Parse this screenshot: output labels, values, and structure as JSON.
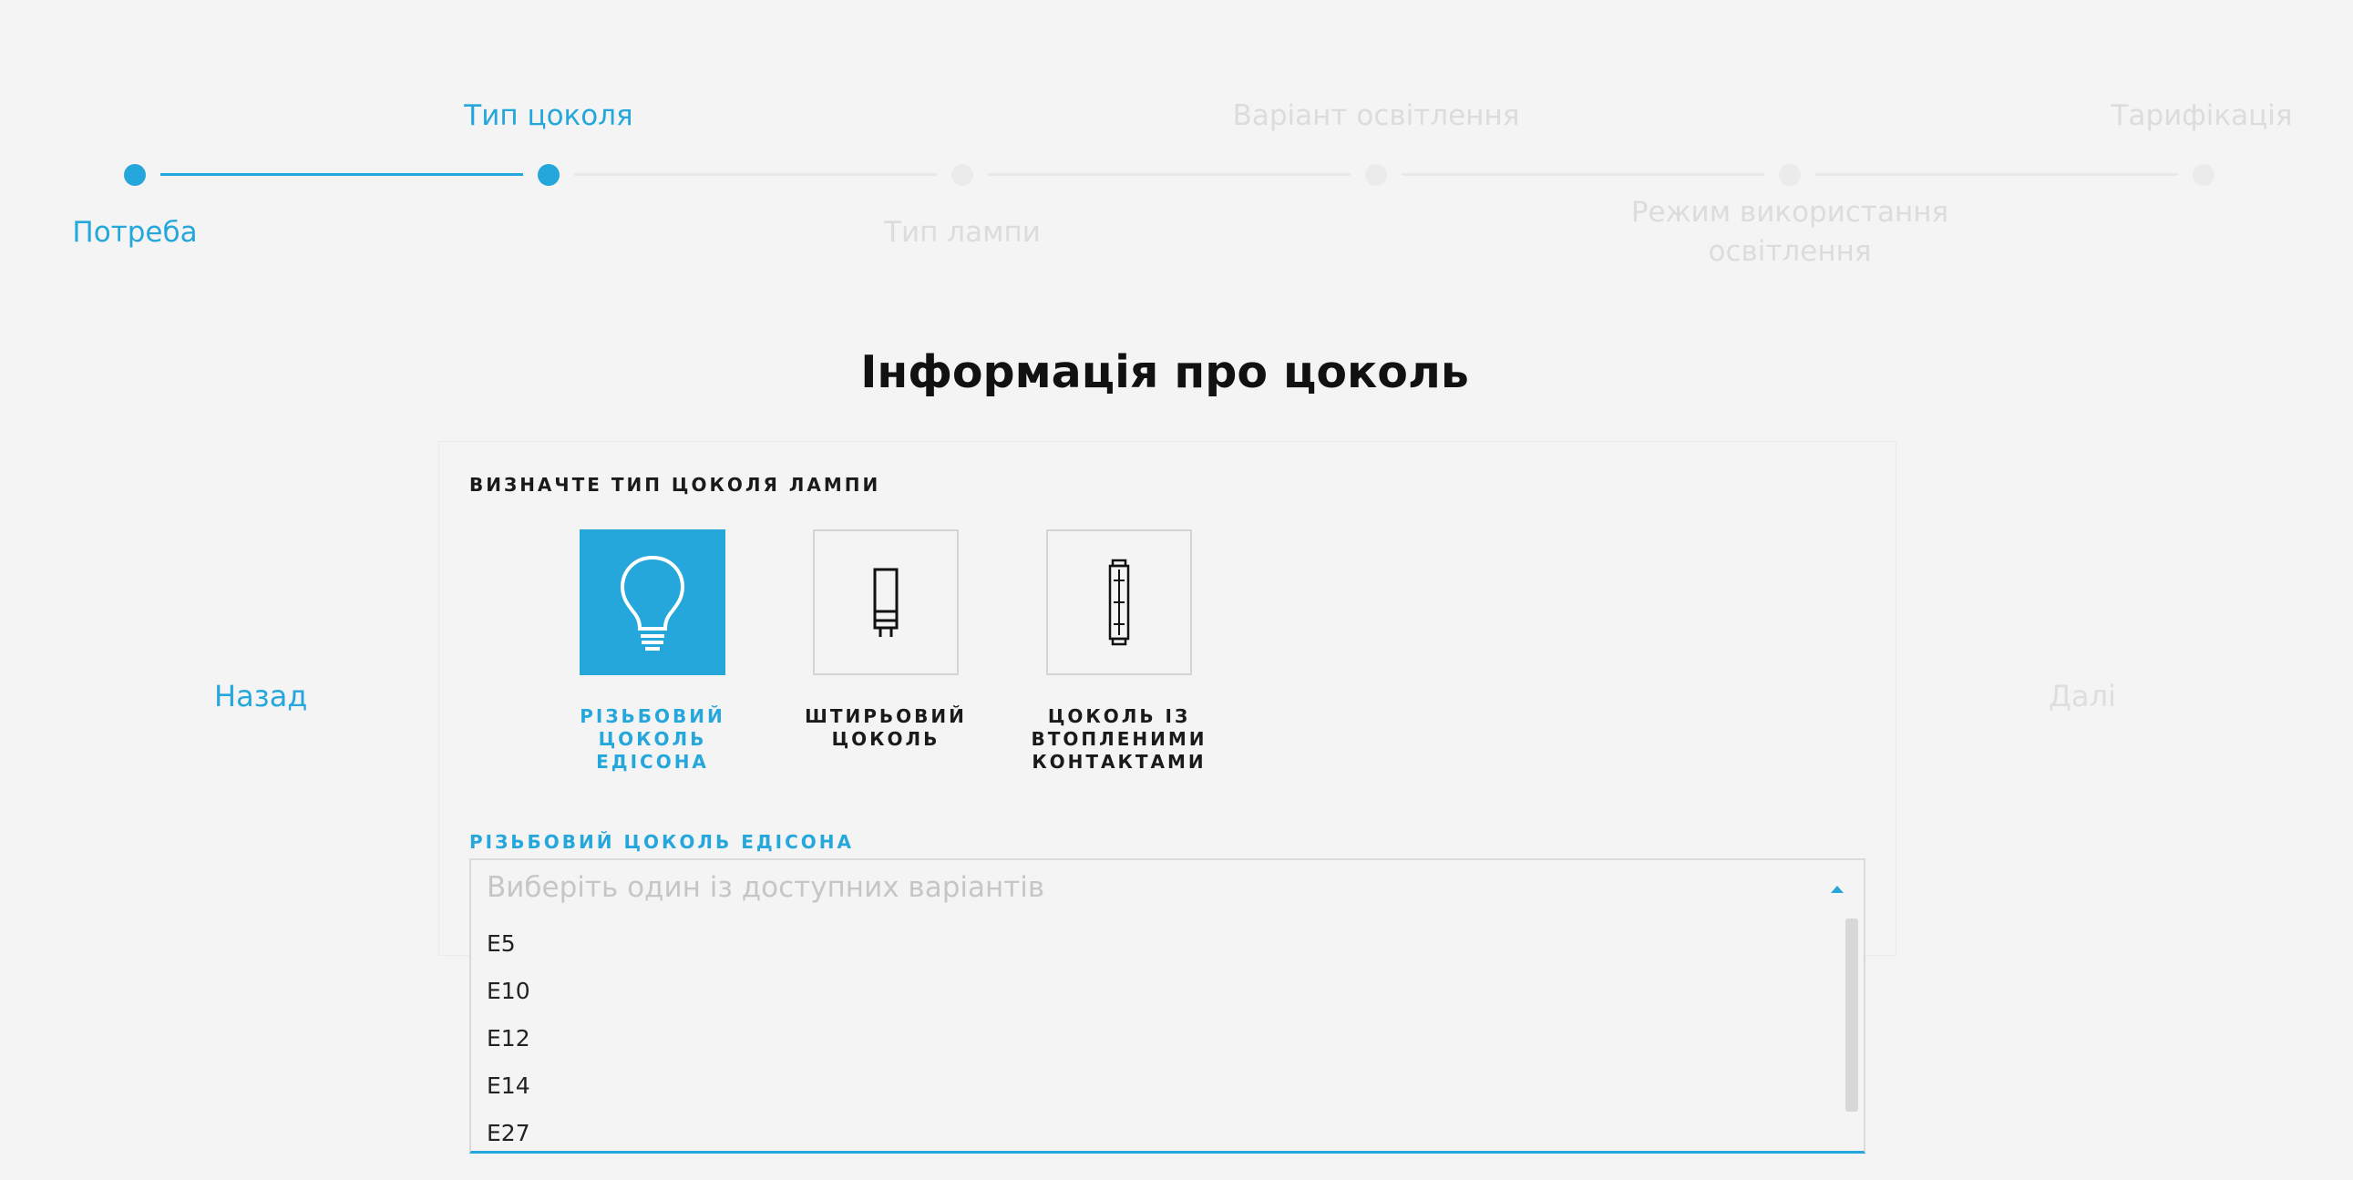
{
  "stepper": {
    "steps": [
      {
        "label": "Потреба",
        "state": "done"
      },
      {
        "label": "Тип цоколя",
        "state": "current"
      },
      {
        "label": "Тип лампи",
        "state": "todo"
      },
      {
        "label": "Варіант освітлення",
        "state": "todo"
      },
      {
        "label": "Режим використання освітлення",
        "state": "todo"
      },
      {
        "label": "Тарифікація",
        "state": "todo"
      }
    ],
    "step5_line1": "Режим використання",
    "step5_line2": "освітлення"
  },
  "nav": {
    "back": "Назад",
    "next": "Далі"
  },
  "page_title": "Інформація про цоколь",
  "form": {
    "section_label": "ВИЗНАЧТЕ ТИП ЦОКОЛЯ ЛАМПИ",
    "options": [
      {
        "line1": "РІЗЬБОВИЙ",
        "line2": "ЦОКОЛЬ ЕДІСОНА",
        "line3": "",
        "icon": "bulb-icon",
        "selected": true
      },
      {
        "line1": "ШТИРЬОВИЙ",
        "line2": "ЦОКОЛЬ",
        "line3": "",
        "icon": "pin-base-lamp-icon",
        "selected": false
      },
      {
        "line1": "ЦОКОЛЬ ІЗ",
        "line2": "ВТОПЛЕНИМИ",
        "line3": "КОНТАКТАМИ",
        "icon": "recessed-contact-lamp-icon",
        "selected": false
      }
    ],
    "dropdown_label": "РІЗЬБОВИЙ ЦОКОЛЬ ЕДІСОНА",
    "dropdown_placeholder": "Виберіть один із доступних варіантів",
    "dropdown_options": [
      "E5",
      "E10",
      "E12",
      "E14",
      "E27"
    ]
  },
  "colors": {
    "accent": "#25a7dc",
    "background": "#f4f4f4",
    "inactive_text": "#dcdcdc"
  }
}
